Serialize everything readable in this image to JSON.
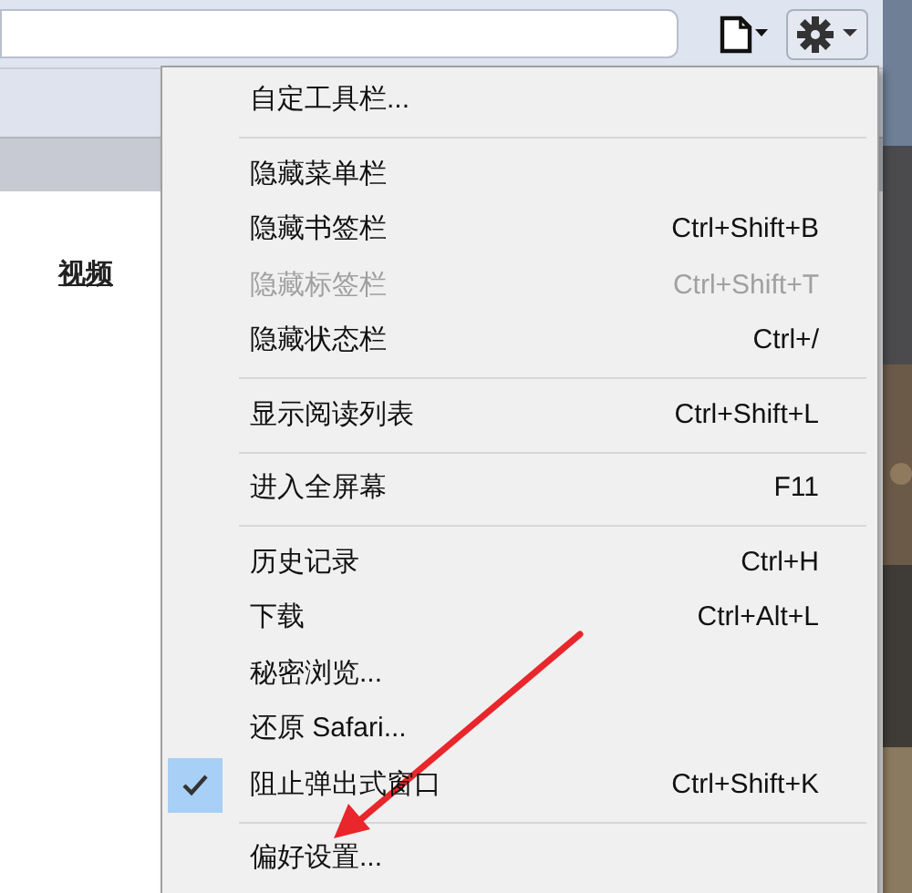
{
  "page": {
    "links": [
      "视频"
    ]
  },
  "menu": {
    "items": [
      {
        "kind": "item",
        "label": "自定工具栏...",
        "disabled": false,
        "checked": false
      },
      {
        "kind": "separator"
      },
      {
        "kind": "item",
        "label": "隐藏菜单栏",
        "disabled": false,
        "checked": false
      },
      {
        "kind": "item",
        "label": "隐藏书签栏",
        "shortcut": "Ctrl+Shift+B",
        "disabled": false,
        "checked": false
      },
      {
        "kind": "item",
        "label": "隐藏标签栏",
        "shortcut": "Ctrl+Shift+T",
        "disabled": true,
        "checked": false
      },
      {
        "kind": "item",
        "label": "隐藏状态栏",
        "shortcut": "Ctrl+/",
        "disabled": false,
        "checked": false
      },
      {
        "kind": "separator"
      },
      {
        "kind": "item",
        "label": "显示阅读列表",
        "shortcut": "Ctrl+Shift+L",
        "disabled": false,
        "checked": false
      },
      {
        "kind": "separator"
      },
      {
        "kind": "item",
        "label": "进入全屏幕",
        "shortcut": "F11",
        "disabled": false,
        "checked": false
      },
      {
        "kind": "separator"
      },
      {
        "kind": "item",
        "label": "历史记录",
        "shortcut": "Ctrl+H",
        "disabled": false,
        "checked": false
      },
      {
        "kind": "item",
        "label": "下载",
        "shortcut": "Ctrl+Alt+L",
        "disabled": false,
        "checked": false
      },
      {
        "kind": "item",
        "label": "秘密浏览...",
        "disabled": false,
        "checked": false
      },
      {
        "kind": "item",
        "label": "还原 Safari...",
        "disabled": false,
        "checked": false
      },
      {
        "kind": "item",
        "label": "阻止弹出式窗口",
        "shortcut": "Ctrl+Shift+K",
        "disabled": false,
        "checked": true
      },
      {
        "kind": "separator"
      },
      {
        "kind": "item",
        "label": "偏好设置...",
        "disabled": false,
        "checked": false
      }
    ]
  }
}
